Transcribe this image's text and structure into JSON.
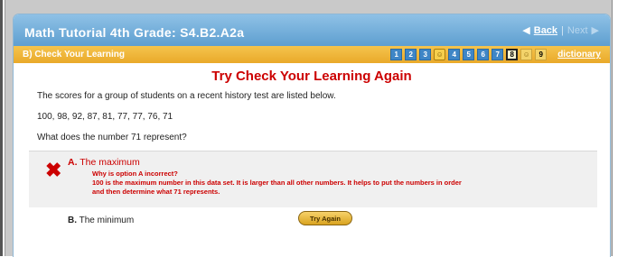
{
  "header": {
    "title": "Math Tutorial 4th Grade: S4.B2.A2a",
    "back_label": "Back",
    "separator": "|",
    "next_label": "Next"
  },
  "section": {
    "label": "B) Check Your Learning",
    "pages": [
      "1",
      "2",
      "3",
      "☺",
      "4",
      "5",
      "6",
      "7",
      "8",
      "☺",
      "9"
    ],
    "current_page": "8",
    "dictionary_label": "dictionary"
  },
  "main": {
    "heading": "Try Check Your Learning Again",
    "intro": "The scores for a group of students on a recent history test are listed below.",
    "scores": "100, 98, 92, 87, 81, 77, 77, 76, 71",
    "question": "What does the number 71 represent?",
    "option_a": {
      "letter": "A.",
      "text": "The maximum",
      "feedback_title": "Why is option A incorrect?",
      "feedback_line1": "100 is the maximum number in this data set. It is larger than all other numbers. It helps to put the numbers in order",
      "feedback_line2": "and then determine what 71 represents."
    },
    "option_b": {
      "letter": "B.",
      "text": "The minimum"
    },
    "try_again_label": "Try Again"
  },
  "colors": {
    "title_bar": "#6aa9d8",
    "section_bar": "#eeb53a",
    "heading_red": "#cc0000"
  }
}
